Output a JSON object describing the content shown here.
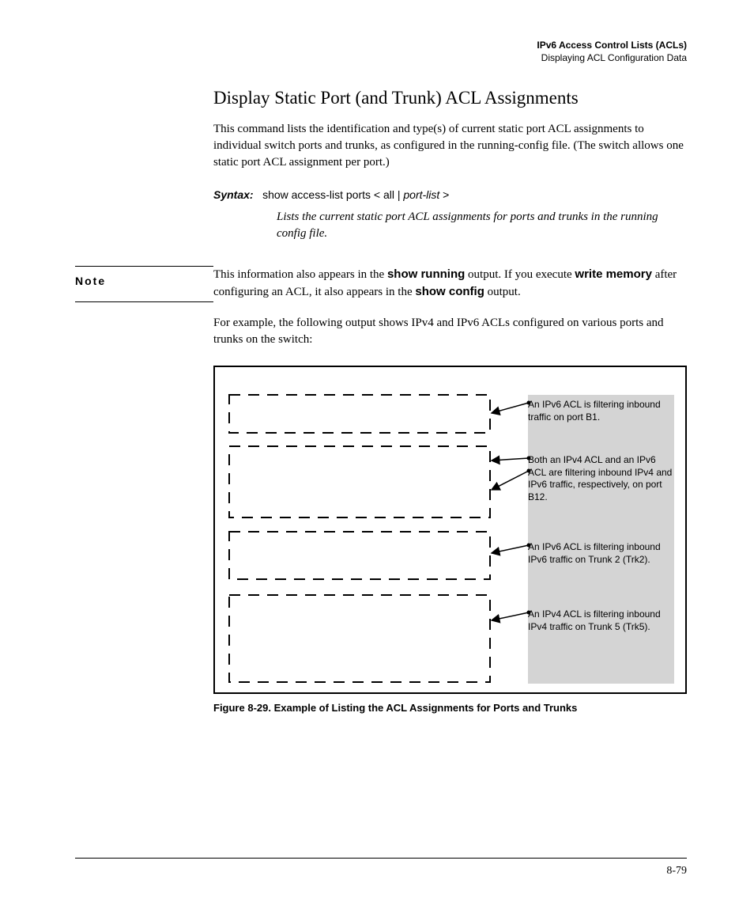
{
  "header": {
    "chapter": "IPv6 Access Control Lists (ACLs)",
    "section": "Displaying ACL Configuration Data"
  },
  "title": "Display Static Port (and Trunk) ACL Assignments",
  "intro": "This command lists the identification and type(s) of current static port ACL assignments to individual switch ports and trunks, as configured in the running-config file. (The switch allows one static port ACL assignment per port.)",
  "syntax": {
    "label": "Syntax:",
    "command": "show access-list ports < all | ",
    "arg": "port-list",
    "command_end": " >",
    "desc": "Lists the current static port ACL assignments for ports and trunks in the running config file."
  },
  "note": {
    "label": "Note",
    "part1": "This information also appears in the ",
    "bold1": "show running",
    "part2": " output. If you execute ",
    "bold2": "write memory",
    "part3": " after configuring an ACL, it also appears in the ",
    "bold3": "show config",
    "part4": " output."
  },
  "example_intro": "For example, the following output shows IPv4 and IPv6 ACLs configured on various ports and trunks on the switch:",
  "callouts": [
    "An IPv6 ACL is filtering inbound traffic on port B1.",
    "Both an IPv4 ACL and an IPv6 ACL are filtering inbound IPv4 and IPv6 traffic, respectively, on port B12.",
    "An IPv6 ACL is filtering inbound IPv6 traffic on Trunk 2 (Trk2).",
    "An IPv4 ACL is filtering inbound IPv4 traffic on Trunk 5 (Trk5)."
  ],
  "figure_caption": "Figure 8-29. Example of Listing the ACL Assignments for Ports and Trunks",
  "page_number": "8-79"
}
